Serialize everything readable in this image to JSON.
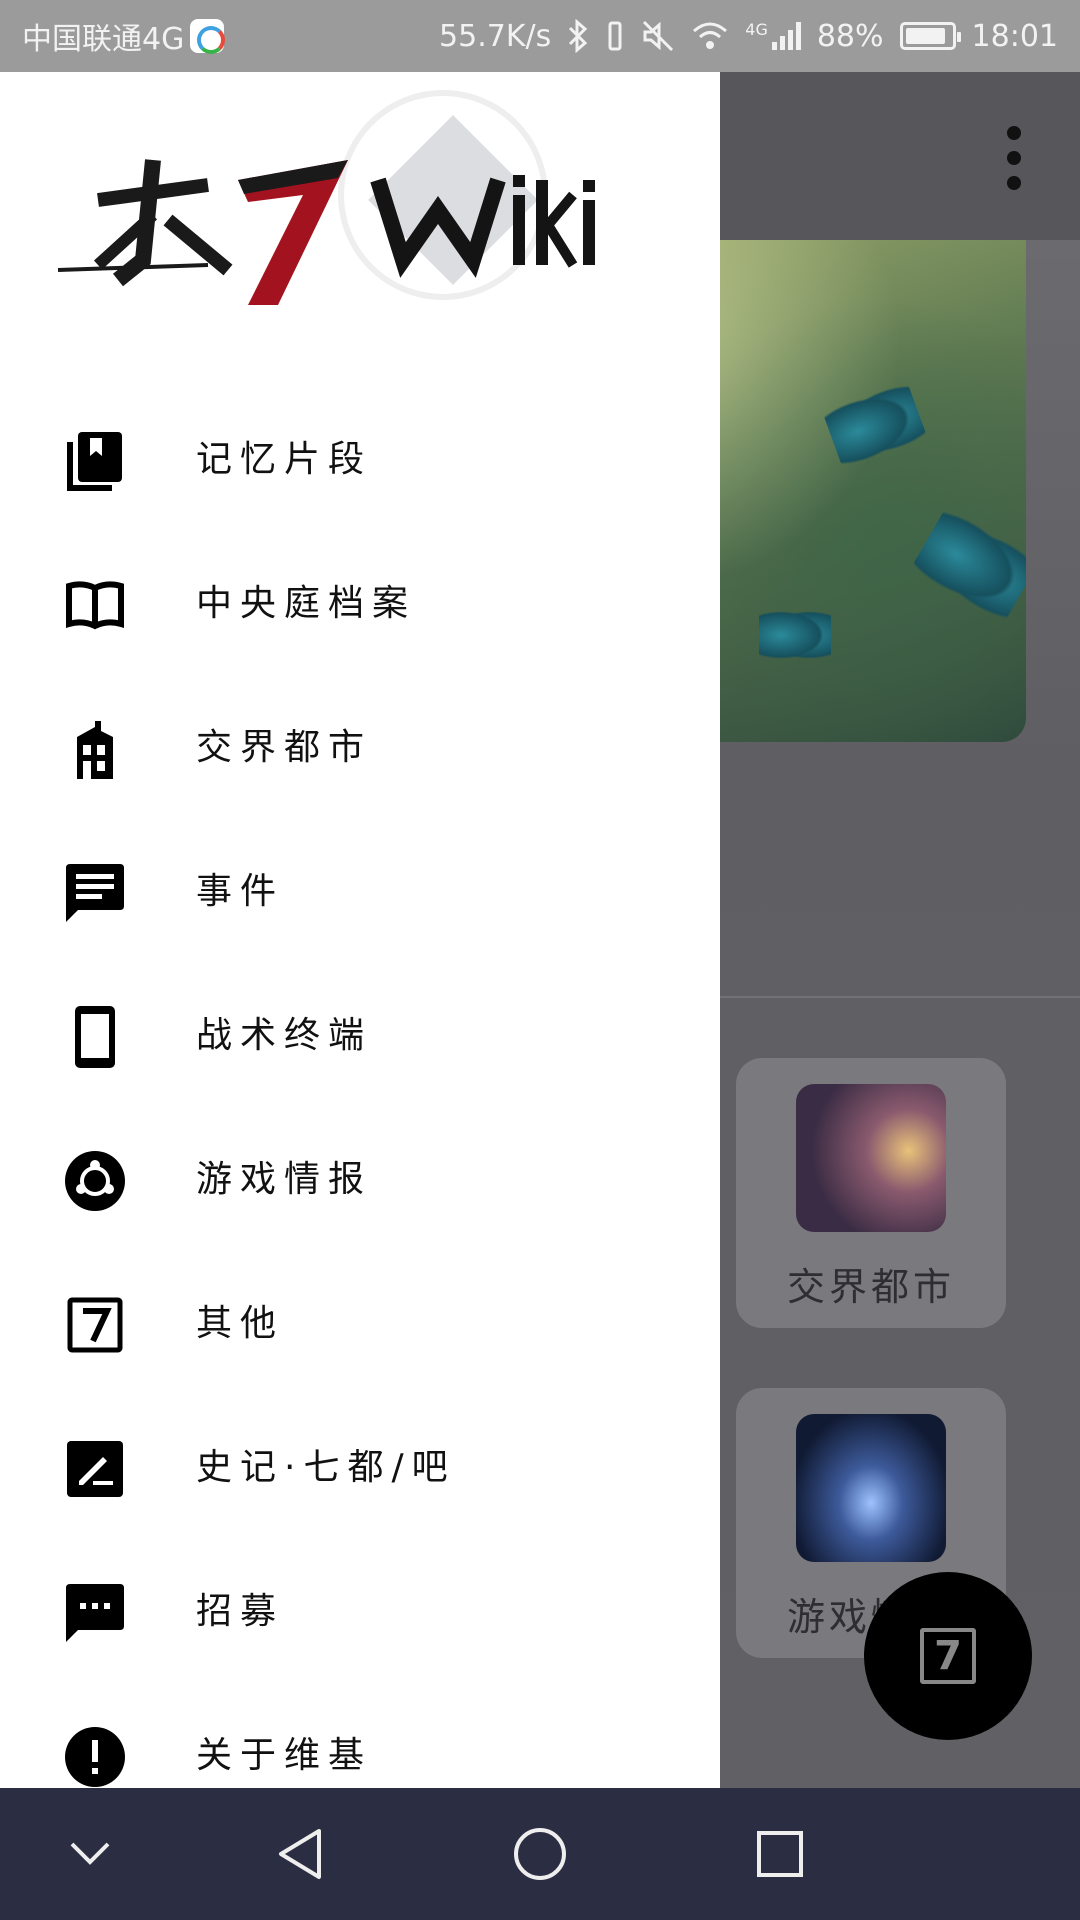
{
  "status_bar": {
    "carrier": "中国联通4G",
    "network_speed": "55.7K/s",
    "network_type": "4G",
    "battery_percent": "88%",
    "battery_level": 0.88,
    "time": "18:01"
  },
  "drawer": {
    "menu": [
      {
        "label": "记忆片段",
        "icon": "bookmarks-icon"
      },
      {
        "label": "中央庭档案",
        "icon": "open-book-icon"
      },
      {
        "label": "交界都市",
        "icon": "building-icon"
      },
      {
        "label": "事件",
        "icon": "message-lines-icon"
      },
      {
        "label": "战术终端",
        "icon": "tablet-icon"
      },
      {
        "label": "游戏情报",
        "icon": "ubuntu-circle-icon"
      },
      {
        "label": "其他",
        "icon": "seven-box-icon"
      },
      {
        "label": "史记·七都/吧",
        "icon": "edit-box-icon"
      },
      {
        "label": "招募",
        "icon": "chat-dots-icon"
      },
      {
        "label": "关于维基",
        "icon": "alert-circle-icon"
      }
    ]
  },
  "background": {
    "cards": [
      {
        "label": "交界都市"
      },
      {
        "label": "游戏情报"
      }
    ],
    "fab_label": "7"
  }
}
